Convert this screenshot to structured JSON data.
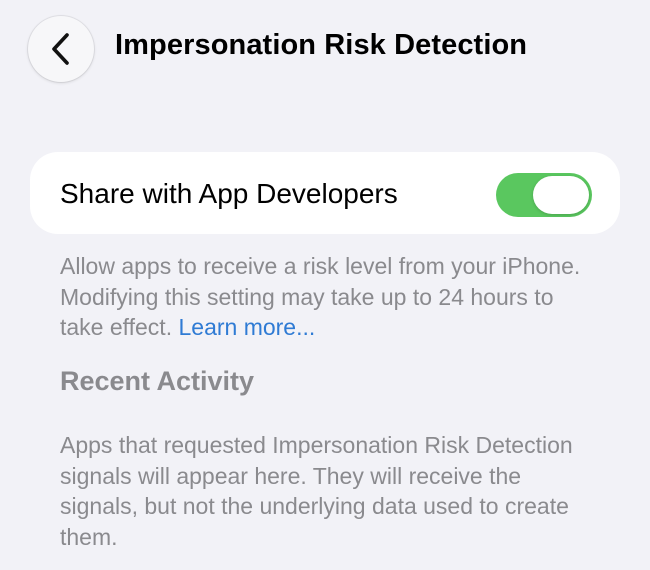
{
  "nav": {
    "back_icon": "chevron-left-icon",
    "title": "Impersonation Risk Detection"
  },
  "setting": {
    "label": "Share with App Developers",
    "enabled": true,
    "toggle_color": "#5ac75f"
  },
  "footnote": {
    "text": "Allow apps to receive a risk level from your iPhone. Modifying this setting may take up to 24 hours to take effect. ",
    "link": "Learn more..."
  },
  "recent_activity": {
    "header": "Recent Activity",
    "empty_text": "Apps that requested Impersonation Risk Detection signals will appear here. They will receive the signals, but not the underlying data used to create them."
  },
  "colors": {
    "background": "#f2f2f7",
    "link": "#2f7bd4",
    "secondary_text": "#8a8a8e"
  }
}
